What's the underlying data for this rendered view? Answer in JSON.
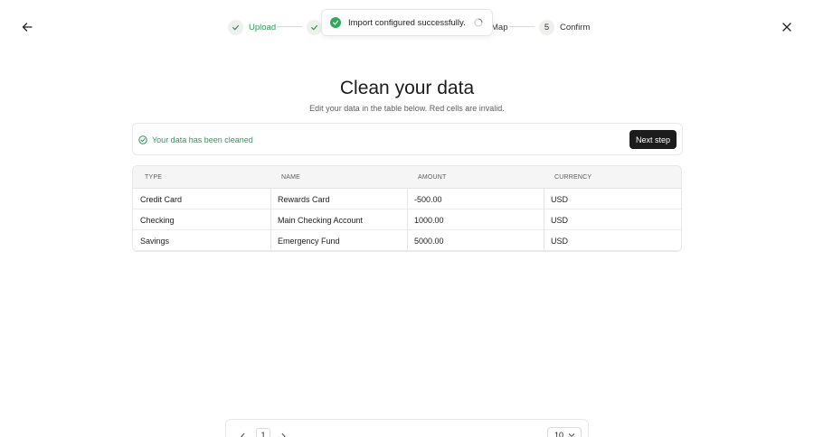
{
  "icons": {
    "back": "arrow-left-icon",
    "close": "close-icon",
    "step_done": "check-icon",
    "toast_status": "check-circle-icon",
    "toast_loading": "spinner-icon",
    "banner_status": "check-circle-outline-icon",
    "prev": "chevron-left-icon",
    "next": "chevron-right-icon",
    "select": "chevron-down-icon"
  },
  "stepper": {
    "steps": [
      {
        "label": "Upload",
        "state": "done"
      },
      {
        "label": "",
        "state": "done"
      },
      {
        "label": "Map",
        "state": "pending"
      },
      {
        "number": "5",
        "label": "Confirm",
        "state": "pending"
      }
    ]
  },
  "toast": {
    "message": "Import configured successfully."
  },
  "header": {
    "title": "Clean your data",
    "subtitle": "Edit your data in the table below. Red cells are invalid."
  },
  "banner": {
    "message": "Your data has been cleaned",
    "button": "Next step"
  },
  "table": {
    "columns": [
      "TYPE",
      "NAME",
      "AMOUNT",
      "CURRENCY"
    ],
    "rows": [
      [
        "Credit Card",
        "Rewards Card",
        "-500.00",
        "USD"
      ],
      [
        "Checking",
        "Main Checking Account",
        "1000.00",
        "USD"
      ],
      [
        "Savings",
        "Emergency Fund",
        "5000.00",
        "USD"
      ]
    ]
  },
  "pagination": {
    "page": "1",
    "page_size": "10"
  },
  "colors": {
    "success": "#2f9a4f",
    "toast_success": "#2faa5a",
    "primary_button": "#1c1c1c"
  }
}
